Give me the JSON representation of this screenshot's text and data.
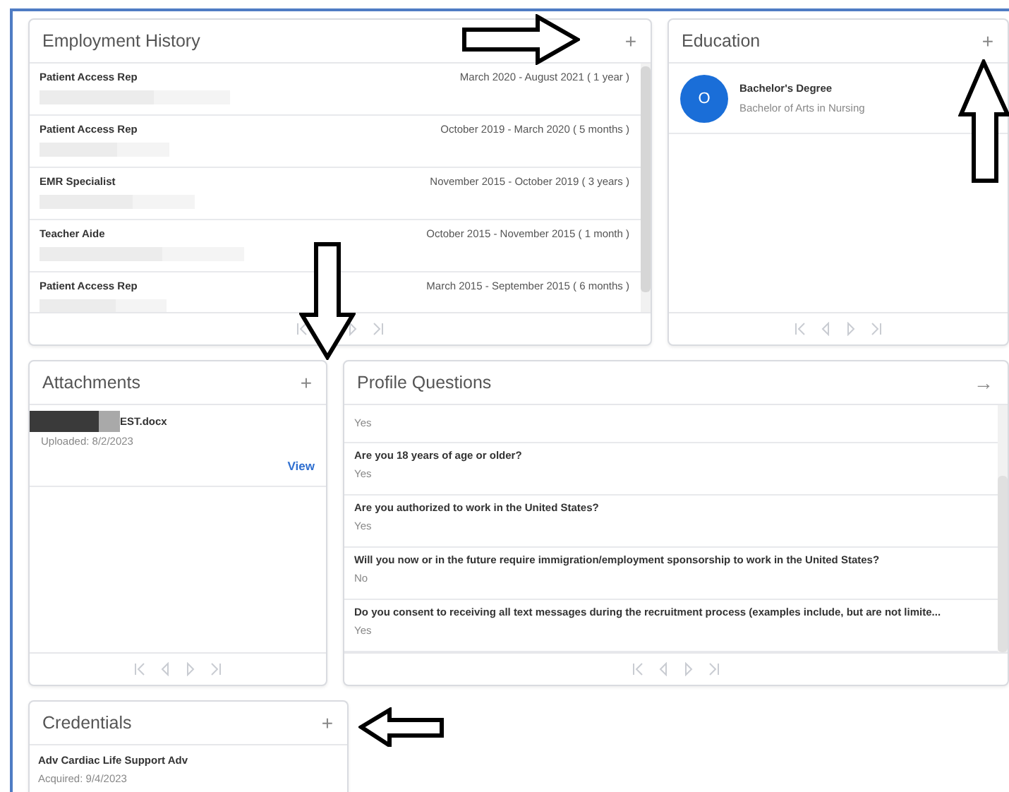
{
  "employment_history": {
    "title": "Employment History",
    "action": "+",
    "rows": [
      {
        "title": "Patient Access Rep",
        "dates": "March 2020 - August 2021 ( 1 year )"
      },
      {
        "title": "Patient Access Rep",
        "dates": "October 2019 - March 2020 ( 5 months )"
      },
      {
        "title": "EMR Specialist",
        "dates": "November 2015 - October 2019 ( 3 years )"
      },
      {
        "title": "Teacher Aide",
        "dates": "October 2015 - November 2015 ( 1 month )"
      },
      {
        "title": "Patient Access Rep",
        "dates": "March 2015 - September 2015 ( 6 months )"
      }
    ]
  },
  "education": {
    "title": "Education",
    "action": "+",
    "items": [
      {
        "avatar": "O",
        "degree": "Bachelor's Degree",
        "field": "Bachelor of Arts in Nursing"
      }
    ]
  },
  "attachments": {
    "title": "Attachments",
    "action": "+",
    "items": [
      {
        "file_name": "EST.docx",
        "uploaded": "Uploaded: 8/2/2023",
        "link": "View"
      }
    ]
  },
  "profile_questions": {
    "title": "Profile Questions",
    "action": "→",
    "items": [
      {
        "answer": "Yes"
      },
      {
        "question": "Are you 18 years of age or older?",
        "answer": "Yes"
      },
      {
        "question": "Are you authorized to work in the United States?",
        "answer": "Yes"
      },
      {
        "question": "Will you now or in the future require immigration/employment sponsorship to work in the United States?",
        "answer": "No"
      },
      {
        "question": "Do you consent to receiving all text messages during the recruitment process (examples include, but are not limite...",
        "answer": "Yes"
      }
    ]
  },
  "credentials": {
    "title": "Credentials",
    "action": "+",
    "items": [
      {
        "name": "Adv Cardiac Life Support Adv",
        "acquired": "Acquired: 9/4/2023"
      }
    ]
  }
}
